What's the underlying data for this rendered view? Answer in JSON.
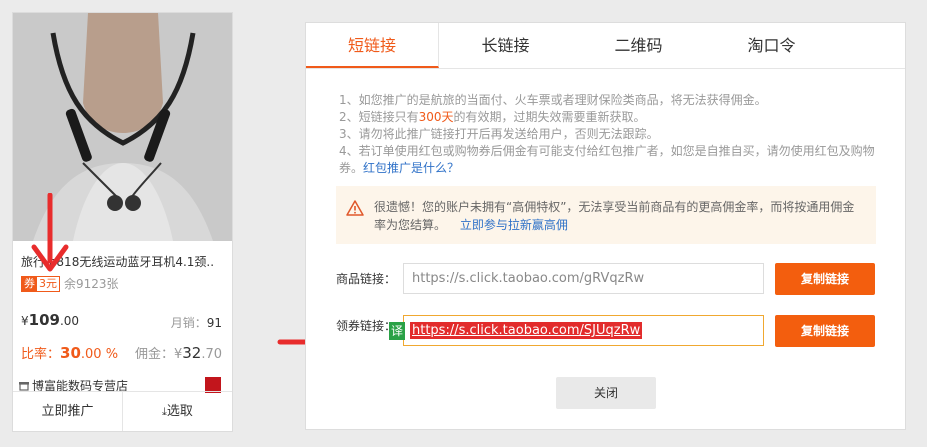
{
  "product": {
    "title": "旅行 n818无线运动蓝牙耳机4.1颈..",
    "coupon_tag": "券",
    "coupon_amount": "3元",
    "remaining": "余9123张",
    "price_symbol": "¥",
    "price_int": "109",
    "price_dec": ".00",
    "sales_label": "月销：",
    "sales_value": "91",
    "ratio_label": "比率：",
    "ratio_int": "30",
    "ratio_dec": ".00 %",
    "commission_label": "佣金：¥",
    "commission_value": "32",
    "commission_dec": ".70",
    "shop_name": "博富能数码专营店",
    "promote_button": "立即推广",
    "select_button": "选取"
  },
  "dialog": {
    "tabs": [
      {
        "label": "短链接",
        "active": true
      },
      {
        "label": "长链接",
        "active": false
      },
      {
        "label": "二维码",
        "active": false
      },
      {
        "label": "淘口令",
        "active": false
      }
    ],
    "tips": {
      "line1": "1、如您推广的是航旅的当面付、火车票或者理财保险类商品，将无法获得佣金。",
      "line2_pre": "2、短链接只有",
      "line2_hl": "300天",
      "line2_post": "的有效期，过期失效需要重新获取。",
      "line3": "3、请勿将此推广链接打开后再发送给用户，否则无法跟踪。",
      "line4": "4、若订单使用红包或购物券后佣金有可能支付给红包推广者，如您是自推自买，请勿使用红包及购物券。",
      "line4_link": "红包推广是什么？"
    },
    "warning": {
      "text": "很遗憾！您的账户未拥有“高佣特权”，无法享受当前商品有的更高佣金率，而将按通用佣金率为您结算。",
      "link": "立即参与拉新赢高佣"
    },
    "product_link": {
      "label": "商品链接：",
      "value": "https://s.click.taobao.com/gRVqzRw",
      "copy_label": "复制链接"
    },
    "coupon_link": {
      "label": "领券链接：",
      "value": "https://s.click.taobao.com/SJUqzRw",
      "translate_badge": "译",
      "copy_label": "复制链接"
    },
    "close_label": "关闭"
  },
  "colors": {
    "accent": "#f05a1a",
    "button": "#f35e0e",
    "link": "#3072c8",
    "annotation_arrow": "#e82c2c"
  }
}
